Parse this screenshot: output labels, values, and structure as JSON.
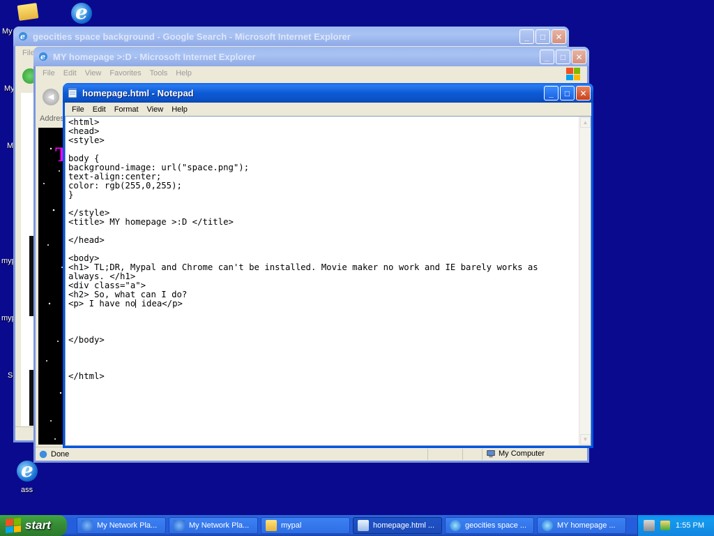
{
  "desktop": {
    "icons": [
      {
        "label": "My",
        "name": "my-documents"
      },
      {
        "label": "My",
        "name": "my-computer"
      },
      {
        "label": "M",
        "name": "my-network"
      },
      {
        "label": "myp",
        "name": "mypal-folder"
      },
      {
        "label": "myp",
        "name": "mypal-app"
      },
      {
        "label": "S",
        "name": "shortcut"
      },
      {
        "label": "ass",
        "name": "ass-shortcut"
      }
    ]
  },
  "ie_back": {
    "title": "geocities space background - Google Search - Microsoft Internet Explorer",
    "menu": [
      "File"
    ]
  },
  "ie_front": {
    "title": "MY homepage >:D - Microsoft Internet Explorer",
    "menu": [
      "File",
      "Edit",
      "View",
      "Favorites",
      "Tools",
      "Help"
    ],
    "address_label": "Address",
    "status_text": "Done",
    "zone_text": "My Computer"
  },
  "notepad": {
    "title": "homepage.html - Notepad",
    "menu": [
      "File",
      "Edit",
      "Format",
      "View",
      "Help"
    ],
    "content_before_caret": "<html>\n<head>\n<style>\n\nbody {\nbackground-image: url(\"space.png\");\ntext-align:center;\ncolor: rgb(255,0,255);\n}\n\n</style>\n<title> MY homepage >:D </title>\n\n</head>\n\n<body>\n<h1> TL;DR, Mypal and Chrome can't be installed. Movie maker no work and IE barely works as always. </h1>\n<div class=\"a\">\n<h2> So, what can I do?\n<p> I have no",
    "content_after_caret": " idea</p>\n\n\n\n</body>\n\n\n\n</html>"
  },
  "taskbar": {
    "start_label": "start",
    "tasks": [
      {
        "label": "My Network Pla...",
        "icon": "network-icon"
      },
      {
        "label": "My Network Pla...",
        "icon": "network-icon"
      },
      {
        "label": "mypal",
        "icon": "folder-icon"
      },
      {
        "label": "homepage.html ...",
        "icon": "notepad-icon",
        "active": true
      },
      {
        "label": "geocities space ...",
        "icon": "ie-icon"
      },
      {
        "label": "MY homepage ...",
        "icon": "ie-icon"
      }
    ],
    "clock": "1:55 PM"
  },
  "colors": {
    "desktop": "#0a0a8e",
    "xp_blue": "#0054e3",
    "start_green": "#388e38"
  }
}
